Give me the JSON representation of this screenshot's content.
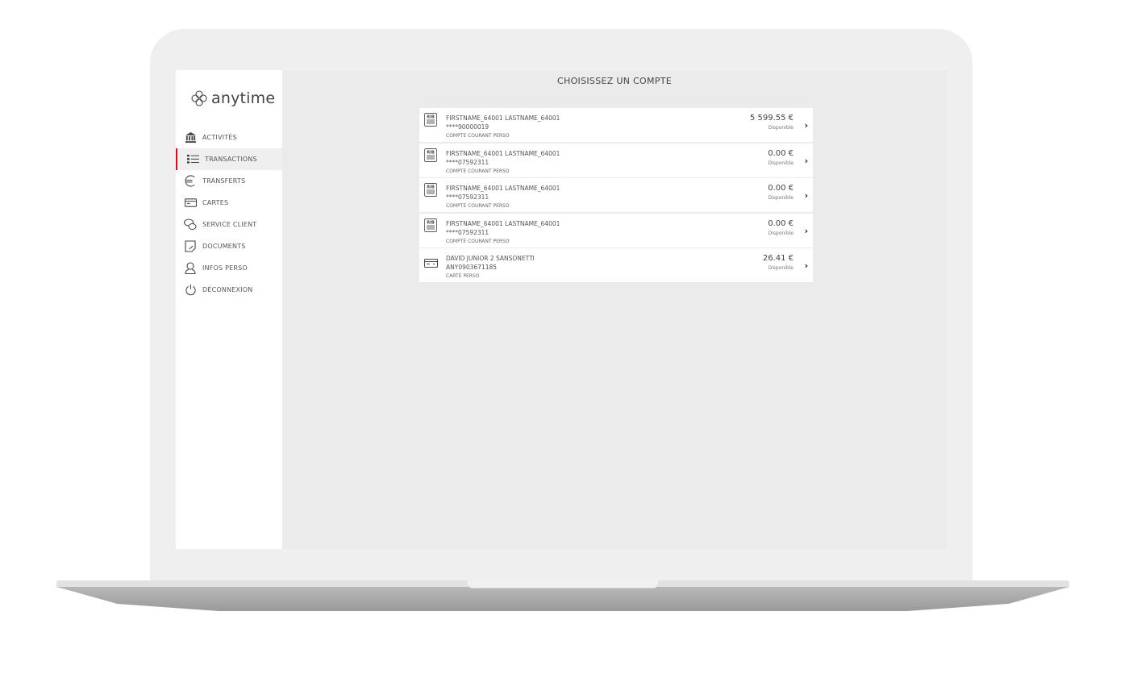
{
  "app": {
    "brand": "anytime"
  },
  "sidebar": {
    "items": [
      {
        "label": "ACTIVITÉS",
        "icon": "bank-icon",
        "active": false
      },
      {
        "label": "TRANSACTIONS",
        "icon": "list-icon",
        "active": true
      },
      {
        "label": "TRANSFERTS",
        "icon": "euro-icon",
        "active": false
      },
      {
        "label": "CARTES",
        "icon": "card-icon",
        "active": false
      },
      {
        "label": "SERVICE CLIENT",
        "icon": "chat-icon",
        "active": false
      },
      {
        "label": "DOCUMENTS",
        "icon": "document-icon",
        "active": false
      },
      {
        "label": "INFOS PERSO",
        "icon": "user-icon",
        "active": false
      },
      {
        "label": "DÉCONNEXION",
        "icon": "power-icon",
        "active": false
      }
    ]
  },
  "main": {
    "title": "CHOISISSEZ UN COMPTE",
    "accounts": [
      {
        "icon": "rib-icon",
        "holder": "FIRSTNAME_64001 LASTNAME_64001",
        "number": "****90000019",
        "type": "COMPTE COURANT PERSO",
        "balance": "5 599.55 €",
        "balance_label": "Disponible"
      },
      {
        "icon": "rib-icon",
        "holder": "FIRSTNAME_64001 LASTNAME_64001",
        "number": "****07592311",
        "type": "COMPTE COURANT PERSO",
        "balance": "0.00 €",
        "balance_label": "Disponible"
      },
      {
        "icon": "rib-icon",
        "holder": "FIRSTNAME_64001 LASTNAME_64001",
        "number": "****07592311",
        "type": "COMPTE COURANT PERSO",
        "balance": "0.00 €",
        "balance_label": "Disponible"
      },
      {
        "icon": "rib-icon",
        "holder": "FIRSTNAME_64001 LASTNAME_64001",
        "number": "****07592311",
        "type": "COMPTE COURANT PERSO",
        "balance": "0.00 €",
        "balance_label": "Disponible"
      },
      {
        "icon": "card-icon",
        "holder": "DAVID JUNIOR 2 SANSONETTI",
        "number": "ANY0903671185",
        "type": "CARTE PERSO",
        "balance": "26.41 €",
        "balance_label": "Disponible"
      }
    ]
  },
  "colors": {
    "accent": "#e3001b",
    "background": "#ebebeb"
  }
}
